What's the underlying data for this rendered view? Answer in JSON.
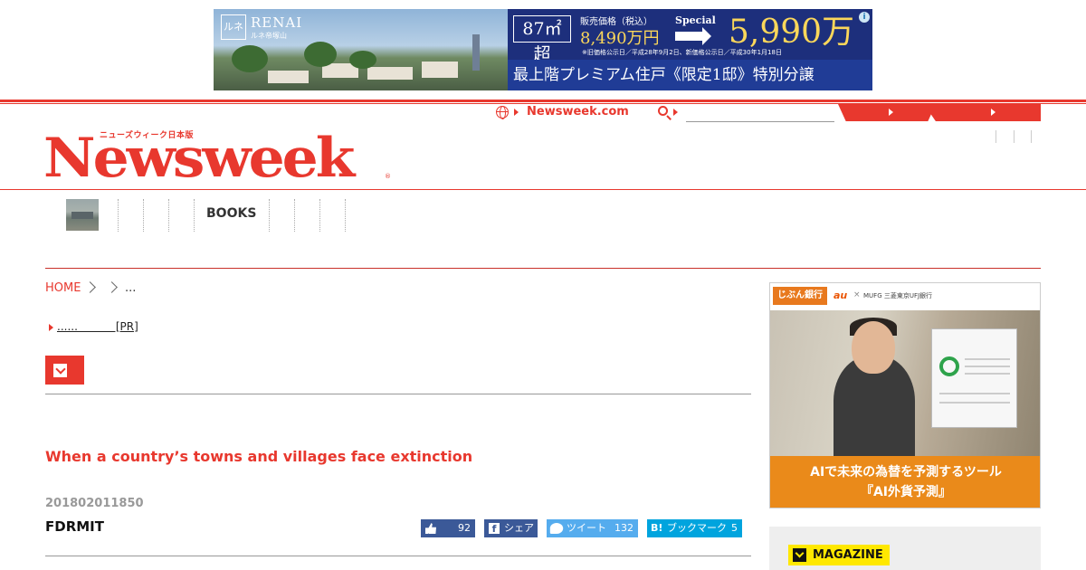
{
  "top_ad": {
    "logo_mark": "ルネ",
    "brand": "RENAI",
    "brand_sub": "ルネ帝塚山",
    "area": "87㎡超",
    "price_label": "販売価格（税込）",
    "old_price": "8,490万円",
    "special": "Special",
    "new_price": "5,990万円",
    "note": "※旧価格公示日／平成28年9月2日、新価格公示日／平成30年1月18日",
    "headline": "最上階プレミアム住戸《限定1邸》特別分譲",
    "info_glyph": "i"
  },
  "header": {
    "site_link": "Newsweek.com",
    "search_placeholder": "",
    "logo_jp": "ニューズウィーク日本版",
    "logo": "Newsweek",
    "logo_reg": "®"
  },
  "nav": {
    "items": [
      "BOOKS"
    ]
  },
  "breadcrumb": {
    "home": "HOME",
    "current": "..."
  },
  "pr_link": "......           [PR]",
  "article": {
    "headline": "When a country’s towns and villages face extinction",
    "date": "201802011850",
    "author": "FDRMIT"
  },
  "share": {
    "like_count": "92",
    "fb_glyph": "f",
    "fb_label": "シェア",
    "tw_label": "ツイート",
    "tw_count": "132",
    "hb_glyph": "B!",
    "hb_label": "ブックマーク",
    "hb_count": "5"
  },
  "side_ad": {
    "bank": "じぶん銀行",
    "au": "au",
    "x": "×",
    "mufg": "MUFG 三菱東京UFJ銀行",
    "line1": "AIで未来の為替を予測するツール",
    "line2": "『AI外貨予測』"
  },
  "magazine": {
    "label": "MAGAZINE"
  },
  "colors": {
    "brand_red": "#e8382e",
    "facebook": "#3b5998",
    "twitter": "#55acee",
    "hatena": "#00a4de",
    "magazine_yellow": "#ffe800",
    "ad_orange": "#ea8a1a"
  }
}
